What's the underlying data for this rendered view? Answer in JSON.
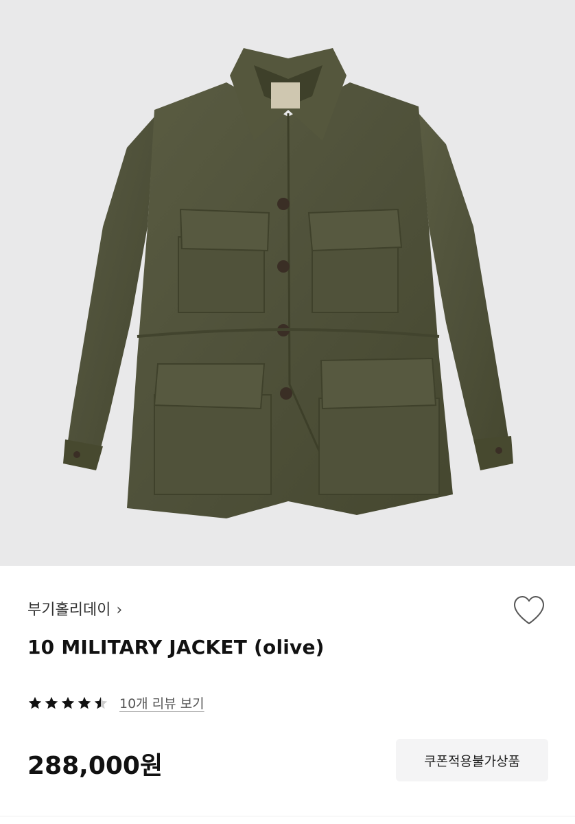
{
  "product": {
    "image_alt": "10 MILITARY JACKET (olive)",
    "brand": "부기홀리데이",
    "brand_chevron": "›",
    "title": "10 MILITARY JACKET (olive)",
    "rating": 4.5,
    "review_link": "10개 리뷰 보기",
    "price": "288,000원",
    "coupon_notice": "쿠폰적용불가상품",
    "wishlist_icon": "heart-outline-icon"
  },
  "colors": {
    "hero_background": "#e9e9ea",
    "jacket": "#4e5038",
    "star": "#111111",
    "coupon_bg": "#f4f4f5"
  }
}
